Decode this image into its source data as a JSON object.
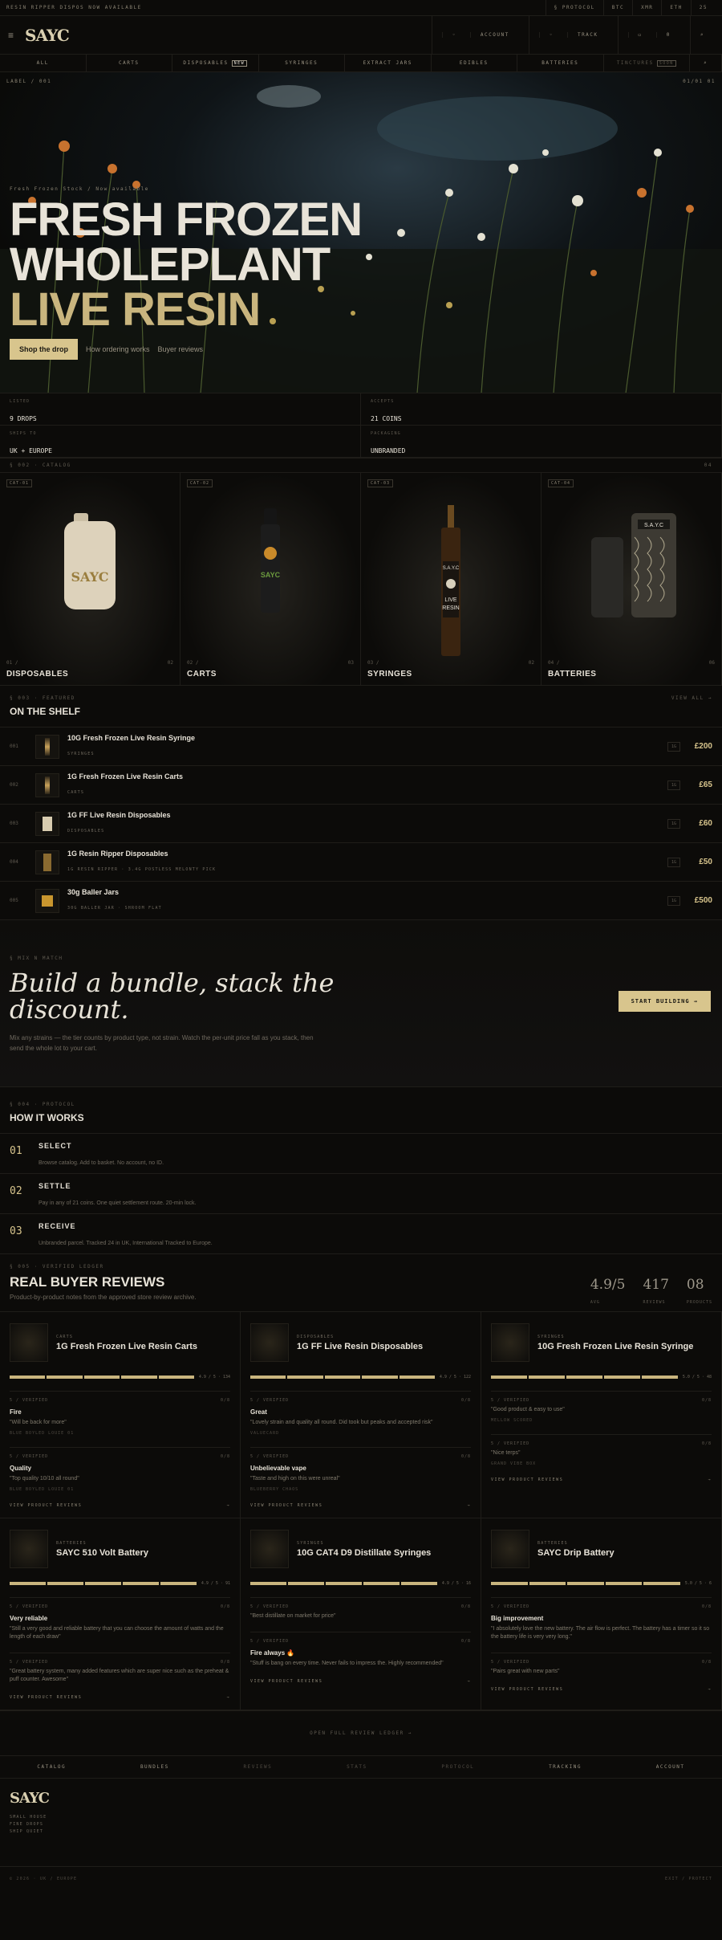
{
  "topbar": {
    "left": "RESIN RIPPER DISPOS NOW AVAILABLE",
    "protocol": "§ PROTOCOL",
    "btc": "BTC",
    "xmr": "XMR",
    "eth": "ETH",
    "more": "25"
  },
  "header": {
    "logo": "SAYC",
    "account": "ACCOUNT",
    "track": "TRACK",
    "basket": "0"
  },
  "nav": [
    {
      "label": "ALL"
    },
    {
      "label": "CARTS"
    },
    {
      "label": "DISPOSABLES",
      "badge": "NEW"
    },
    {
      "label": "SYRINGES"
    },
    {
      "label": "EXTRACT JARS"
    },
    {
      "label": "EDIBLES"
    },
    {
      "label": "BATTERIES"
    },
    {
      "label": "TINCTURES",
      "badge": "SOON"
    }
  ],
  "hero": {
    "crumb_left": "LABEL / 001",
    "crumb_right": "01/01 01",
    "eyebrow": "Fresh Frozen Stock / Now available",
    "line1": "FRESH FROZEN",
    "line2": "WHOLEPLANT",
    "line3": "LIVE RESIN",
    "cta": "Shop the drop",
    "link1": "How ordering works",
    "link2": "Buyer reviews"
  },
  "stats": [
    {
      "label": "LISTED",
      "value": "9 DROPS"
    },
    {
      "label": "ACCEPTS",
      "value": "21 COINS"
    },
    {
      "label": "SHIPS TO",
      "value": "UK + EUROPE"
    },
    {
      "label": "PACKAGING",
      "value": "UNBRANDED"
    }
  ],
  "catalog": {
    "head": "§ 002 · CATALOG",
    "count": "04",
    "items": [
      {
        "tag": "CAT-01",
        "num": "01 /",
        "count": "02",
        "name": "DISPOSABLES"
      },
      {
        "tag": "CAT-02",
        "num": "02 /",
        "count": "03",
        "name": "CARTS"
      },
      {
        "tag": "CAT-03",
        "num": "03 /",
        "count": "02",
        "name": "SYRINGES"
      },
      {
        "tag": "CAT-04",
        "num": "04 /",
        "count": "06",
        "name": "BATTERIES"
      }
    ]
  },
  "shelf": {
    "eyebrow": "§ 003 · FEATURED",
    "viewall": "VIEW ALL →",
    "title": "ON THE SHELF",
    "rows": [
      {
        "idx": "001",
        "name": "10G Fresh Frozen Live Resin Syringe",
        "sub": "SYRINGES",
        "qty": "1G",
        "price": "£200"
      },
      {
        "idx": "002",
        "name": "1G Fresh Frozen Live Resin Carts",
        "sub": "CARTS",
        "qty": "1G",
        "price": "£65"
      },
      {
        "idx": "003",
        "name": "1G FF Live Resin Disposables",
        "sub": "DISPOSABLES",
        "qty": "1G",
        "price": "£60"
      },
      {
        "idx": "004",
        "name": "1G Resin Ripper Disposables",
        "sub": "1G RESIN RIPPER · 3.4G POSTLESS MELONTY PICK",
        "qty": "1G",
        "price": "£50"
      },
      {
        "idx": "005",
        "name": "30g Baller Jars",
        "sub": "30G BALLER JAR · SHROOM FLAT",
        "qty": "1G",
        "price": "£500"
      }
    ]
  },
  "bundle": {
    "eyebrow": "§ MIX N MATCH",
    "title": "Build a bundle, stack the discount.",
    "body": "Mix any strains — the tier counts by product type, not strain. Watch the per-unit price fall as you stack, then send the whole lot to your cart.",
    "cta": "START BUILDING →"
  },
  "how": {
    "eyebrow": "§ 004 · PROTOCOL",
    "title": "HOW IT WORKS",
    "steps": [
      {
        "n": "01",
        "t": "SELECT",
        "d": "Browse catalog. Add to basket. No account, no ID."
      },
      {
        "n": "02",
        "t": "SETTLE",
        "d": "Pay in any of 21 coins. One quiet settlement route. 20-min lock."
      },
      {
        "n": "03",
        "t": "RECEIVE",
        "d": "Unbranded parcel. Tracked 24 in UK, International Tracked to Europe."
      }
    ]
  },
  "reviews": {
    "eyebrow": "§ 005 · VERIFIED LEDGER",
    "title": "REAL BUYER REVIEWS",
    "sub": "Product-by-product notes from the approved store review archive.",
    "kpis": [
      {
        "v": "4.9/5",
        "l": "AVG"
      },
      {
        "v": "417",
        "l": "REVIEWS"
      },
      {
        "v": "08",
        "l": "PRODUCTS"
      }
    ],
    "cards": [
      {
        "cat": "CARTS",
        "name": "1G Fresh Frozen Live Resin Carts",
        "score": "4.9 / 5 · 134",
        "view": "VIEW PRODUCT REVIEWS",
        "items": [
          {
            "meta": "5 / VERIFIED",
            "n": "0/8",
            "t": "Fire",
            "q": "\"Will be back for more\"",
            "who": "BLUE BOYLED LOUIE 01"
          },
          {
            "meta": "5 / VERIFIED",
            "n": "0/8",
            "t": "Quality",
            "q": "\"Top quality 10/10 all round\"",
            "who": "BLUE BOYLED LOUIE 01"
          }
        ]
      },
      {
        "cat": "DISPOSABLES",
        "name": "1G FF Live Resin Disposables",
        "score": "4.9 / 5 · 122",
        "view": "VIEW PRODUCT REVIEWS",
        "items": [
          {
            "meta": "5 / VERIFIED",
            "n": "0/8",
            "t": "Great",
            "q": "\"Lovely strain and quality all round. Did took but peaks and accepted risk\"",
            "who": "VALUECARD"
          },
          {
            "meta": "5 / VERIFIED",
            "n": "0/8",
            "t": "Unbelievable vape",
            "q": "\"Taste and high on this were unreal\"",
            "who": "BLUEBERRY CHAOS"
          }
        ]
      },
      {
        "cat": "SYRINGES",
        "name": "10G Fresh Frozen Live Resin Syringe",
        "score": "5.0 / 5 · 48",
        "view": "VIEW PRODUCT REVIEWS",
        "items": [
          {
            "meta": "5 / VERIFIED",
            "n": "0/8",
            "t": "",
            "q": "\"Good product & easy to use\"",
            "who": "MELLOW SCORED"
          },
          {
            "meta": "5 / VERIFIED",
            "n": "0/8",
            "t": "",
            "q": "\"Nice terps\"",
            "who": "GRAND VIBE BOX"
          }
        ]
      },
      {
        "cat": "BATTERIES",
        "name": "SAYC 510 Volt Battery",
        "score": "4.9 / 5 · 91",
        "view": "VIEW PRODUCT REVIEWS",
        "items": [
          {
            "meta": "5 / VERIFIED",
            "n": "0/8",
            "t": "Very reliable",
            "q": "\"Still a very good and reliable battery that you can choose the amount of watts and the length of each draw\"",
            "who": ""
          },
          {
            "meta": "5 / VERIFIED",
            "n": "0/8",
            "t": "",
            "q": "\"Great battery system, many added features which are super nice such as the preheat & puff counter. Awesome\"",
            "who": ""
          }
        ]
      },
      {
        "cat": "SYRINGES",
        "name": "10G CAT4 D9 Distillate Syringes",
        "score": "4.9 / 5 · 16",
        "view": "VIEW PRODUCT REVIEWS",
        "items": [
          {
            "meta": "5 / VERIFIED",
            "n": "0/8",
            "t": "",
            "q": "\"Best distillate on market for price\"",
            "who": ""
          },
          {
            "meta": "5 / VERIFIED",
            "n": "0/8",
            "t": "Fire always 🔥",
            "q": "\"Stuff is bang on every time. Never fails to impress the. Highly recommended\"",
            "who": ""
          }
        ]
      },
      {
        "cat": "BATTERIES",
        "name": "SAYC Drip Battery",
        "score": "5.0 / 5 · 6",
        "view": "VIEW PRODUCT REVIEWS",
        "items": [
          {
            "meta": "5 / VERIFIED",
            "n": "0/8",
            "t": "Big improvement",
            "q": "\"I absolutely love the new battery. The air flow is perfect. The battery has a timer so it so the battery life is very very long.\"",
            "who": ""
          },
          {
            "meta": "5 / VERIFIED",
            "n": "0/8",
            "t": "",
            "q": "\"Pairs great with new parts\"",
            "who": ""
          }
        ]
      }
    ],
    "fulllink": "OPEN FULL REVIEW LEDGER →"
  },
  "footernav": [
    {
      "l": "CATALOG"
    },
    {
      "l": "BUNDLES"
    },
    {
      "l": "REVIEWS"
    },
    {
      "l": "STATS"
    },
    {
      "l": "PROTOCOL"
    },
    {
      "l": "TRACKING"
    },
    {
      "l": "ACCOUNT"
    }
  ],
  "footer": {
    "logo": "SAYC",
    "l1": "SMALL HOUSE",
    "l2": "FINE DROPS",
    "l3": "SHIP QUIET",
    "copy": "© 2026 · UK / EUROPE",
    "right": "EXIT / PROTECT"
  }
}
